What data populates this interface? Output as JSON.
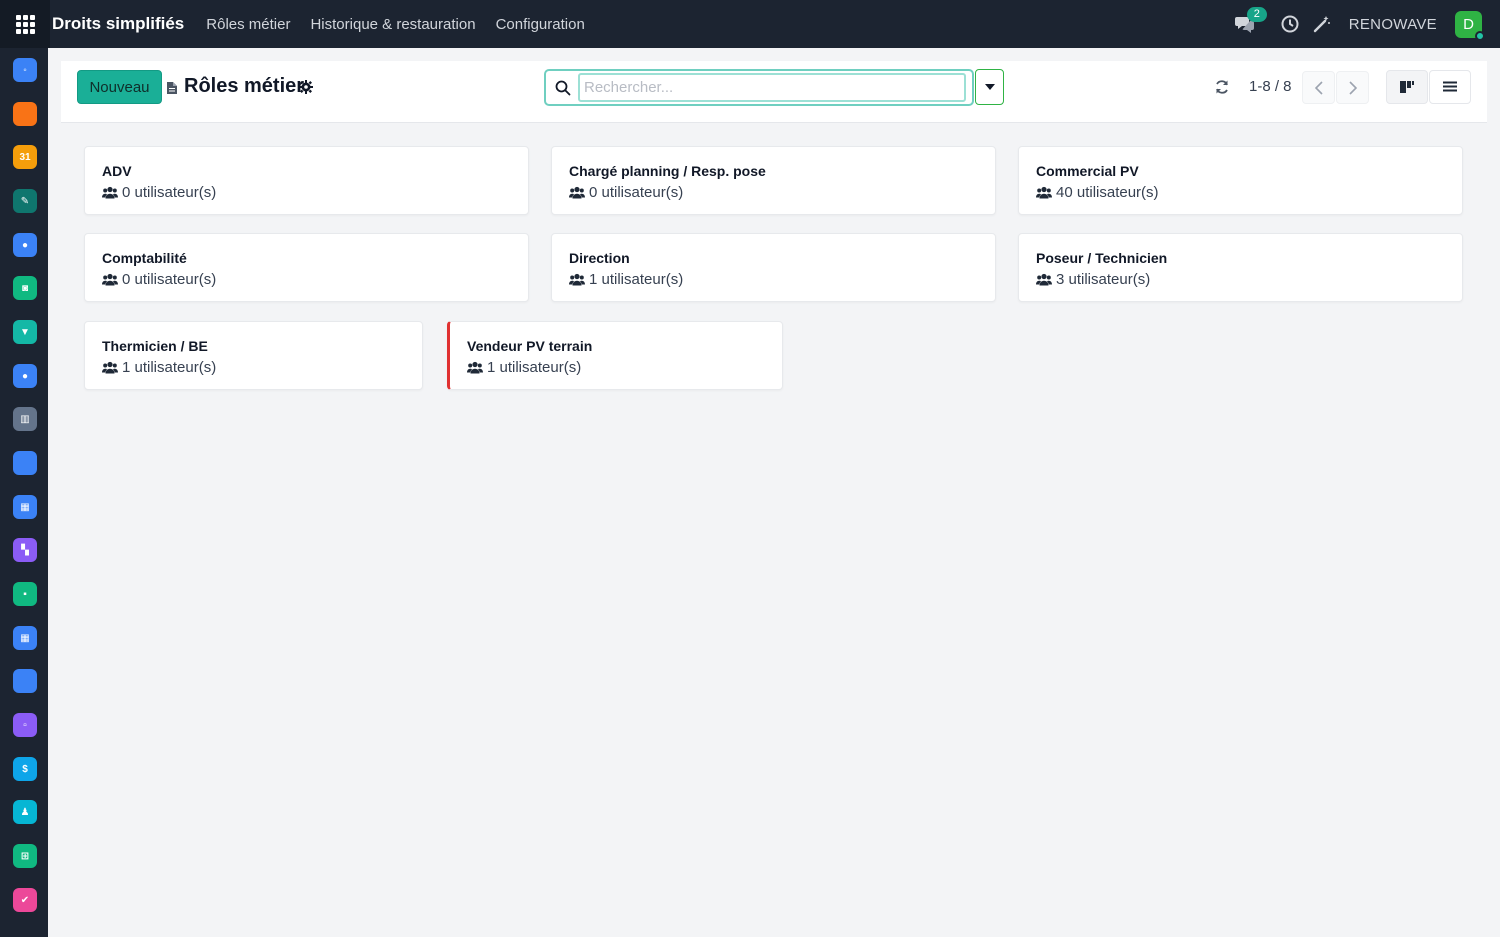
{
  "topbar": {
    "app_name": "Droits simplifiés",
    "menu": [
      "Rôles métier",
      "Historique & restauration",
      "Configuration"
    ],
    "messages_badge": "2",
    "company": "RENOWAVE",
    "avatar_initial": "D"
  },
  "sidebar": {
    "apps": [
      {
        "name": "discuss-app-icon",
        "color": "#3b82f6",
        "glyph": "◦"
      },
      {
        "name": "chat-app-icon",
        "color": "#f97316",
        "glyph": ""
      },
      {
        "name": "calendar-31-app-icon",
        "color": "#f59e0b",
        "glyph": "31"
      },
      {
        "name": "sign-app-icon",
        "color": "#0f766e",
        "glyph": "✎"
      },
      {
        "name": "odoo-app-icon",
        "color": "#3b82f6",
        "glyph": "●"
      },
      {
        "name": "contacts-app-icon",
        "color": "#10b981",
        "glyph": "◙"
      },
      {
        "name": "crm-app-icon",
        "color": "#14b8a6",
        "glyph": "▼"
      },
      {
        "name": "disc-app-icon",
        "color": "#3b82f6",
        "glyph": "●"
      },
      {
        "name": "institution-app-icon",
        "color": "#64748b",
        "glyph": "▥"
      },
      {
        "name": "blank-app-icon",
        "color": "#3b82f6",
        "glyph": ""
      },
      {
        "name": "planning-app-icon",
        "color": "#3b82f6",
        "glyph": "▦"
      },
      {
        "name": "dashboard-app-icon",
        "color": "#8b5cf6",
        "glyph": "▚"
      },
      {
        "name": "project-app-icon",
        "color": "#10b981",
        "glyph": "▪"
      },
      {
        "name": "appointments-app-icon",
        "color": "#3b82f6",
        "glyph": "▦"
      },
      {
        "name": "documents-app-icon",
        "color": "#3b82f6",
        "glyph": ""
      },
      {
        "name": "knowledge-app-icon",
        "color": "#8b5cf6",
        "glyph": "▫"
      },
      {
        "name": "invoicing-app-icon",
        "color": "#0ea5e9",
        "glyph": "$"
      },
      {
        "name": "employees-app-icon",
        "color": "#06b6d4",
        "glyph": "♟"
      },
      {
        "name": "spreadsheet-app-icon",
        "color": "#10b981",
        "glyph": "⊞"
      },
      {
        "name": "tasks-app-icon",
        "color": "#ec4899",
        "glyph": "✔"
      }
    ]
  },
  "control": {
    "new_button": "Nouveau",
    "title": "Rôles métier",
    "search_placeholder": "Rechercher...",
    "pager": "1-8 / 8"
  },
  "cards": [
    {
      "title": "ADV",
      "count": "0 utilisateur(s)"
    },
    {
      "title": "Chargé planning / Resp. pose",
      "count": "0 utilisateur(s)"
    },
    {
      "title": "Commercial PV",
      "count": "40 utilisateur(s)"
    },
    {
      "title": "Comptabilité",
      "count": "0 utilisateur(s)"
    },
    {
      "title": "Direction",
      "count": "1 utilisateur(s)"
    },
    {
      "title": "Poseur / Technicien",
      "count": "3 utilisateur(s)"
    },
    {
      "title": "Thermicien / BE",
      "count": "1 utilisateur(s)"
    },
    {
      "title": "Vendeur PV terrain",
      "count": "1 utilisateur(s)"
    }
  ],
  "colors": {
    "topbar": "#1c2431",
    "primary": "#1aaf97",
    "avatar": "#2fb344",
    "highlight_border": "#e03131"
  }
}
